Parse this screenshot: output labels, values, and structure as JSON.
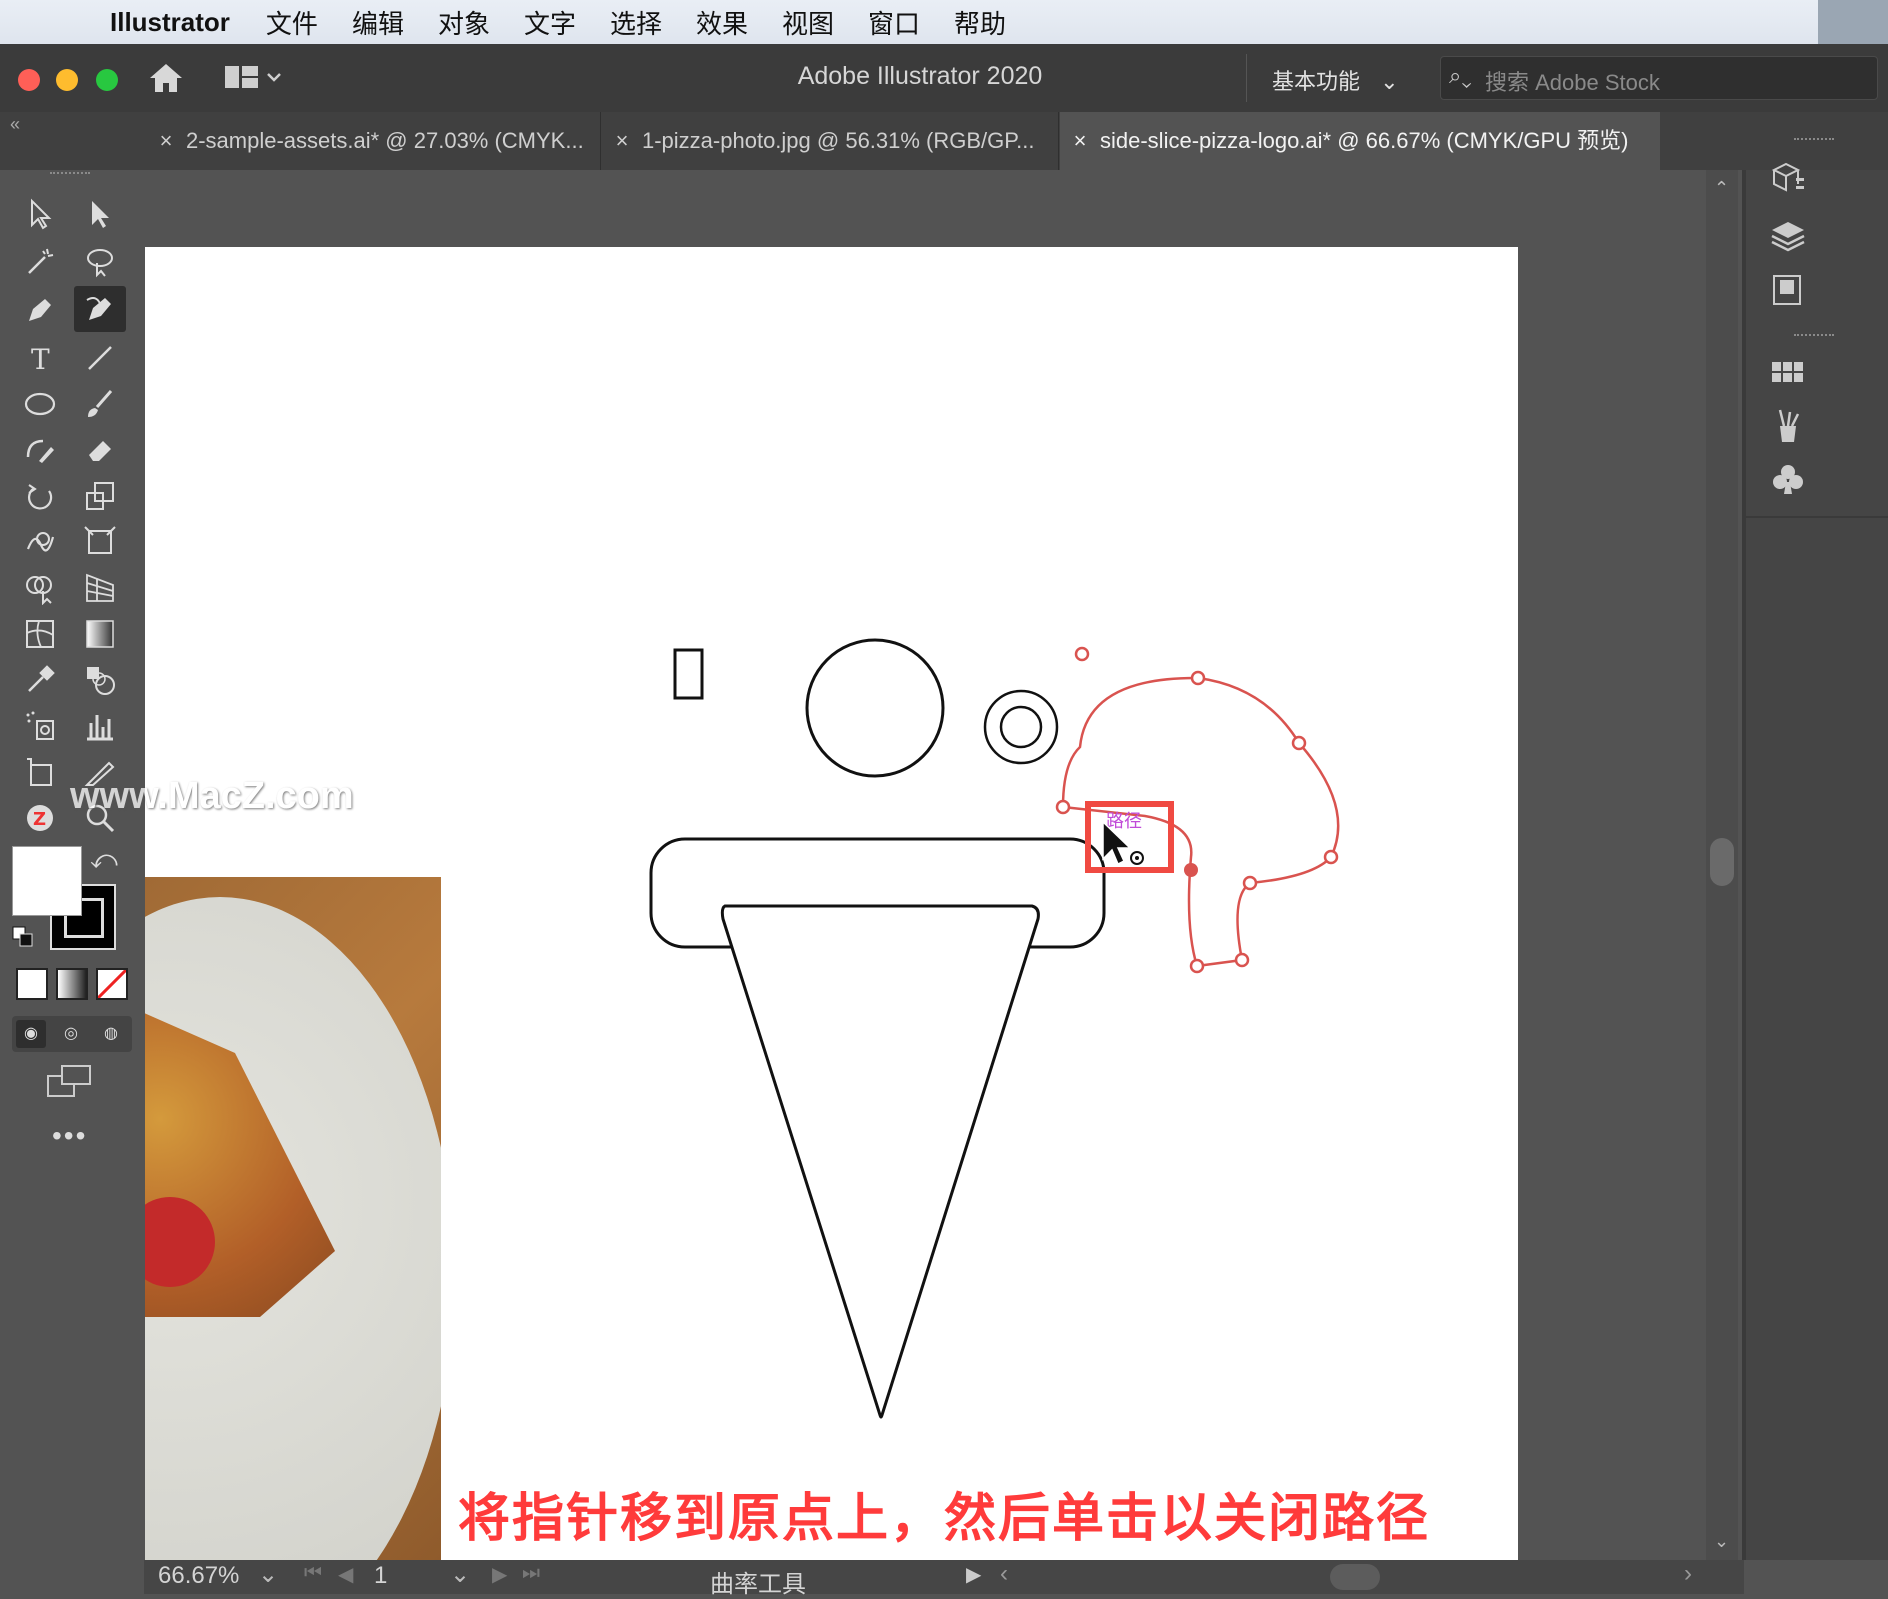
{
  "menubar": {
    "app_name": "Illustrator",
    "items": [
      "文件",
      "编辑",
      "对象",
      "文字",
      "选择",
      "效果",
      "视图",
      "窗口",
      "帮助"
    ]
  },
  "window": {
    "title": "Adobe Illustrator 2020",
    "workspace": "基本功能",
    "search_placeholder": "搜索 Adobe Stock"
  },
  "tabs": [
    {
      "label": "2-sample-assets.ai* @ 27.03% (CMYK...",
      "active": false
    },
    {
      "label": "1-pizza-photo.jpg @ 56.31% (RGB/GP...",
      "active": false
    },
    {
      "label": "side-slice-pizza-logo.ai* @ 66.67% (CMYK/GPU 预览)",
      "active": true
    }
  ],
  "canvas": {
    "path_hint": "路径"
  },
  "statusbar": {
    "zoom": "66.67%",
    "artboard_number": "1",
    "current_tool": "曲率工具"
  },
  "caption": "将指针移到原点上，然后单击以关闭路径",
  "watermark": "www.MacZ.com",
  "colors": {
    "path_red": "#d9534f",
    "highlight_box": "#f04a42",
    "caption_red": "#ff3b3b"
  }
}
